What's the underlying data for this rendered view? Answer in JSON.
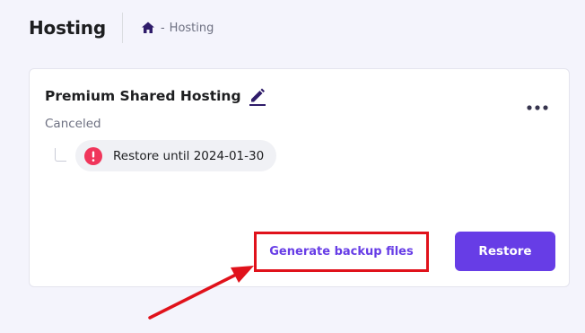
{
  "header": {
    "title": "Hosting",
    "breadcrumb": {
      "home_icon": "home-icon",
      "separator": "-",
      "current": "Hosting"
    }
  },
  "card": {
    "title": "Premium Shared Hosting",
    "edit_icon": "pencil-icon",
    "status": "Canceled",
    "restore_notice": "Restore until 2024-01-30",
    "alert_icon": "exclamation-circle-icon",
    "more_icon": "ellipsis-horizontal-icon",
    "generate_backup_label": "Generate backup files",
    "restore_label": "Restore"
  },
  "annotation": {
    "highlight_color": "#e0121b",
    "arrow_icon": "red-arrow-icon"
  },
  "colors": {
    "accent": "#673de6",
    "alert": "#f0365b",
    "background": "#f4f4fc",
    "card": "#ffffff"
  }
}
